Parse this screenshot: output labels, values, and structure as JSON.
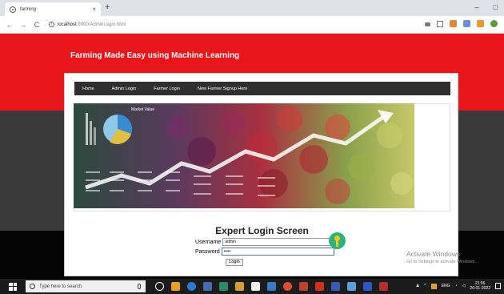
{
  "browser": {
    "tab_title": "farming",
    "tab_close": "×",
    "new_tab": "+",
    "minimize": "–",
    "maximize": "□",
    "back": "←",
    "forward": "→",
    "reload": "C",
    "url_host": "localhost:",
    "url_path": "8000/AdminLogin.html"
  },
  "page": {
    "site_title": "Farming Made Easy using Machine Learning",
    "menu": [
      "Home",
      "Admin Login",
      "Farmer Login",
      "New Farmer Signup Here"
    ],
    "login_title": "Expert Login Screen",
    "username_label": "Username",
    "username_value": "admin",
    "password_label": "Password",
    "password_value": "•••••",
    "login_button": "Login",
    "banner_caption": "Market Value"
  },
  "watermark": {
    "line1": "Activate Windows",
    "line2": "Go to Settings to activate Windows."
  },
  "taskbar": {
    "search_placeholder": "Type here to search",
    "time": "21:56",
    "date": "26-01-2022",
    "lang": "ENG"
  },
  "colors": {
    "header_red": "#e8151a",
    "nav_dark": "#2f2f2f",
    "key_green": "#28b47a"
  }
}
